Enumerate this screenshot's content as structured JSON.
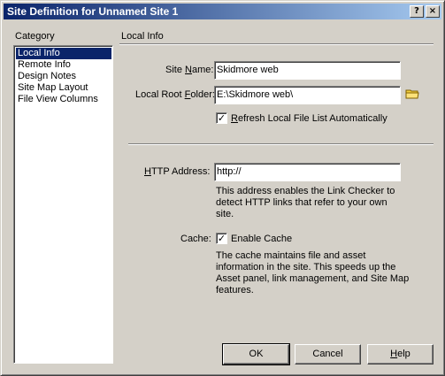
{
  "window": {
    "title": "Site Definition for Unnamed Site 1",
    "help_glyph": "?",
    "close_glyph": "×"
  },
  "category": {
    "label": "Category",
    "items": [
      "Local Info",
      "Remote Info",
      "Design Notes",
      "Site Map Layout",
      "File View Columns"
    ],
    "selected_index": 0
  },
  "section": {
    "title": "Local Info"
  },
  "form": {
    "site_name_label_pre": "Site ",
    "site_name_label_key": "N",
    "site_name_label_post": "ame:",
    "site_name_value": "Skidmore web",
    "root_folder_label_pre": "Local Root ",
    "root_folder_label_key": "F",
    "root_folder_label_post": "older:",
    "root_folder_value": "E:\\Skidmore web\\",
    "refresh_checked": true,
    "refresh_label_key": "R",
    "refresh_label_post": "efresh Local File List Automatically",
    "http_label_key": "H",
    "http_label_post": "TTP Address:",
    "http_value": "http://",
    "http_desc": [
      "This address enables the Link Checker to",
      "detect HTTP links that refer to your own",
      "site."
    ],
    "cache_label": "Cache:",
    "cache_checked": true,
    "cache_option_label": "Enable Cache",
    "cache_desc": [
      "The cache maintains file and asset",
      "information in the site.  This speeds up the",
      "Asset panel, link management, and Site Map",
      "features."
    ],
    "check_glyph": "✓"
  },
  "buttons": {
    "ok": "OK",
    "cancel": "Cancel",
    "help_key": "H",
    "help_post": "elp"
  },
  "colors": {
    "face": "#d4d0c8",
    "title_start": "#0a246a",
    "title_end": "#a6caf0",
    "selection": "#0a246a",
    "folder": "#f4d03f"
  }
}
